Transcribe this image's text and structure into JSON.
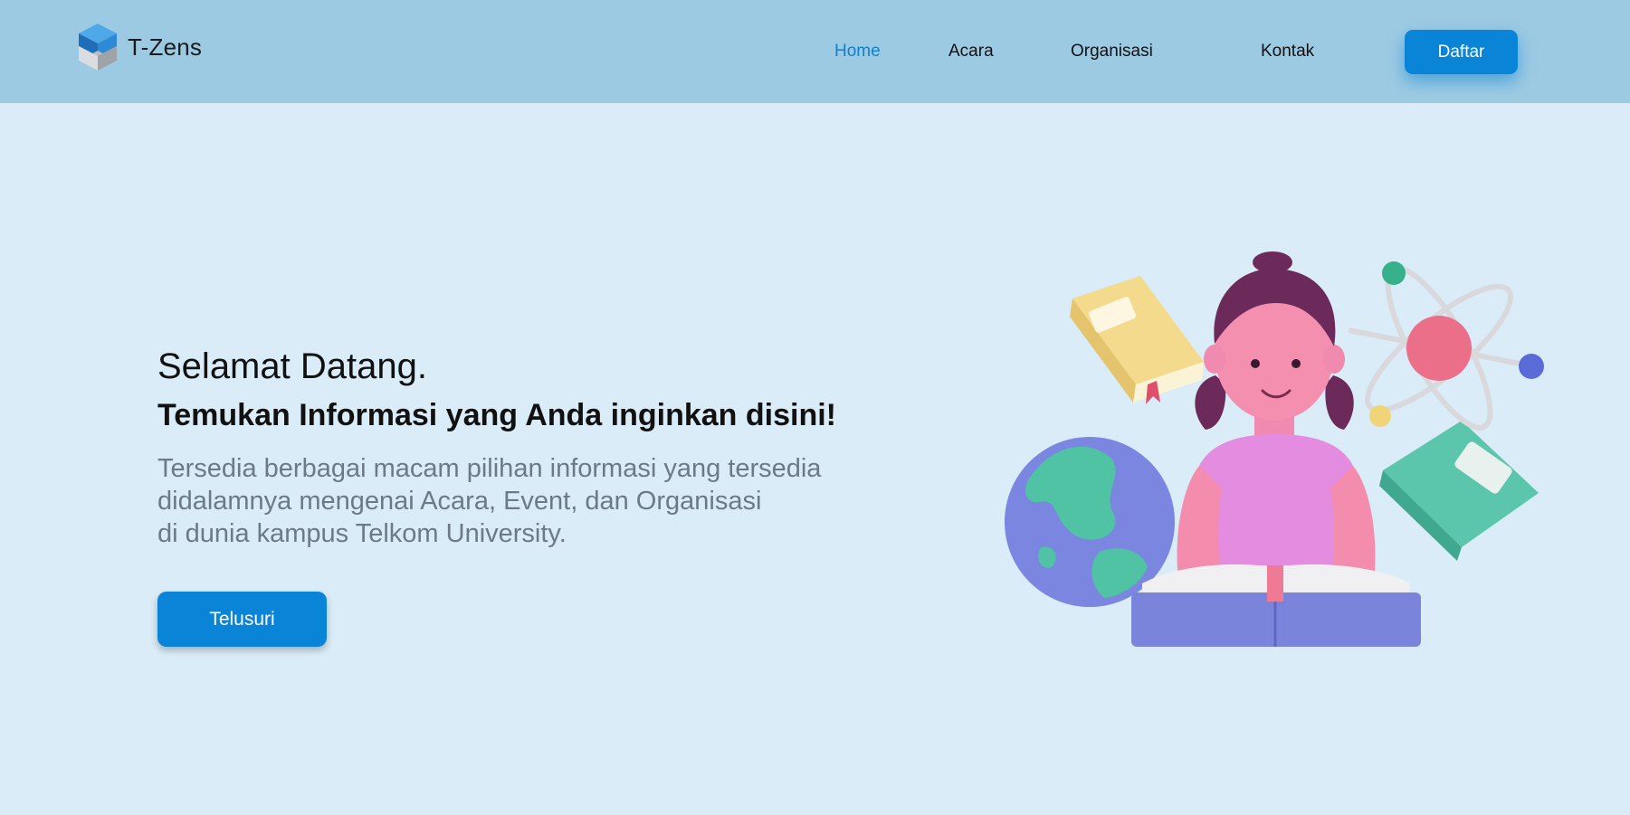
{
  "header": {
    "brand": {
      "name": "T-Zens",
      "icon": "cube-logo-icon"
    },
    "nav": [
      {
        "label": "Home",
        "active": true
      },
      {
        "label": "Acara",
        "active": false
      },
      {
        "label": "Organisasi",
        "active": false
      },
      {
        "label": "Kontak",
        "active": false
      }
    ],
    "cta_label": "Daftar"
  },
  "hero": {
    "greeting": "Selamat Datang.",
    "headline": "Temukan Informasi yang Anda inginkan disini!",
    "description_lines": [
      "Tersedia berbagai macam pilihan informasi yang tersedia",
      "didalamnya mengenai Acara, Event, dan Organisasi",
      "di dunia kampus Telkom University."
    ],
    "button_label": "Telusuri",
    "illustration": "girl-reading-book-with-globe-atom-books"
  },
  "colors": {
    "header_bg": "#9DCAE3",
    "page_bg": "#DAECF7",
    "accent": "#0A84D6",
    "active_nav": "#1080CE",
    "description_text": "#6C7A87"
  }
}
